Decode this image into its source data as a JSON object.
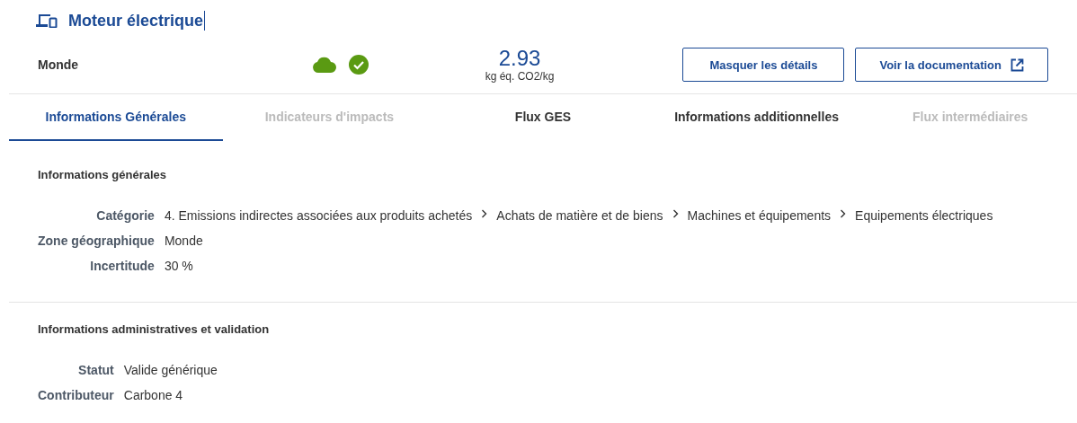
{
  "header": {
    "title": "Moteur électrique",
    "zone": "Monde",
    "value": "2.93",
    "unit": "kg éq. CO2/kg"
  },
  "buttons": [
    {
      "label": "Masquer les détails",
      "kind": "plain"
    },
    {
      "label": "Voir la documentation",
      "kind": "external"
    }
  ],
  "tabs": [
    {
      "label": "Informations Générales",
      "selected": true,
      "disabled": false
    },
    {
      "label": "Indicateurs d'impacts",
      "selected": false,
      "disabled": true
    },
    {
      "label": "Flux GES",
      "selected": false,
      "disabled": false
    },
    {
      "label": "Informations additionnelles",
      "selected": false,
      "disabled": false
    },
    {
      "label": "Flux intermédiaires",
      "selected": false,
      "disabled": true
    }
  ],
  "sections": [
    {
      "title": "Informations générales",
      "fields": [
        {
          "label": "Catégorie",
          "kind": "path",
          "path": [
            "4. Emissions indirectes associées aux produits achetés",
            "Achats de matière et de biens",
            "Machines et équipements",
            "Equipements électriques"
          ]
        },
        {
          "label": "Zone géographique",
          "kind": "text",
          "value": "Monde"
        },
        {
          "label": "Incertitude",
          "kind": "text",
          "value": "30 %"
        }
      ]
    },
    {
      "title": "Informations administratives et validation",
      "fields": [
        {
          "label": "Statut",
          "kind": "text",
          "value": "Valide générique"
        },
        {
          "label": "Contributeur",
          "kind": "text",
          "value": "Carbone 4"
        }
      ]
    }
  ]
}
